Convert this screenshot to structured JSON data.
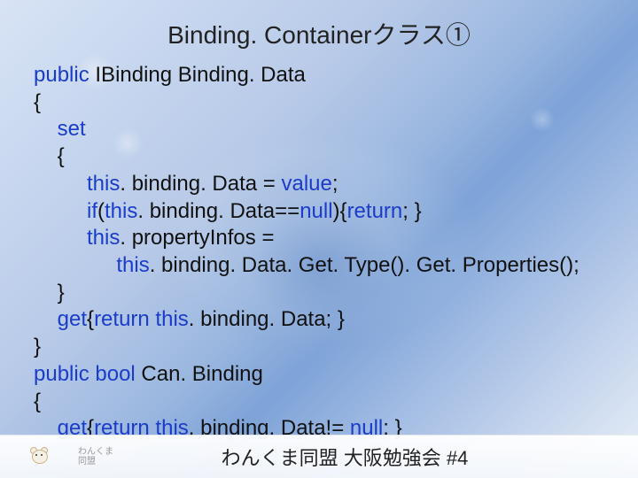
{
  "title": "Binding. Containerクラス①",
  "code": {
    "l1a": "public",
    "l1b": " IBinding Binding. Data",
    "l2": "{",
    "l3a": "    set",
    "l4": "    {",
    "l5a": "         this",
    "l5b": ". binding. Data = ",
    "l5c": "value",
    "l5d": ";",
    "l6a": "         if",
    "l6b": "(",
    "l6c": "this",
    "l6d": ". binding. Data==",
    "l6e": "null",
    "l6f": "){",
    "l6g": "return",
    "l6h": "; }",
    "l7a": "         this",
    "l7b": ". propertyInfos =",
    "l8a": "              this",
    "l8b": ". binding. Data. Get. Type(). Get. Properties();",
    "l9": "    }",
    "l10a": "    get",
    "l10b": "{",
    "l10c": "return",
    "l10d": " this",
    "l10e": ". binding. Data; }",
    "l11": "}",
    "l12a": "public",
    "l12b": " bool",
    "l12c": " Can. Binding",
    "l13": "{",
    "l14a": "    get",
    "l14b": "{",
    "l14c": "return",
    "l14d": " this",
    "l14e": ". binding. Data!= ",
    "l14f": "null",
    "l14g": "; }",
    "l15": "}"
  },
  "footer": {
    "logo_text_line1": "わんくま",
    "logo_text_line2": "同盟",
    "text": "わんくま同盟 大阪勉強会 #4"
  }
}
